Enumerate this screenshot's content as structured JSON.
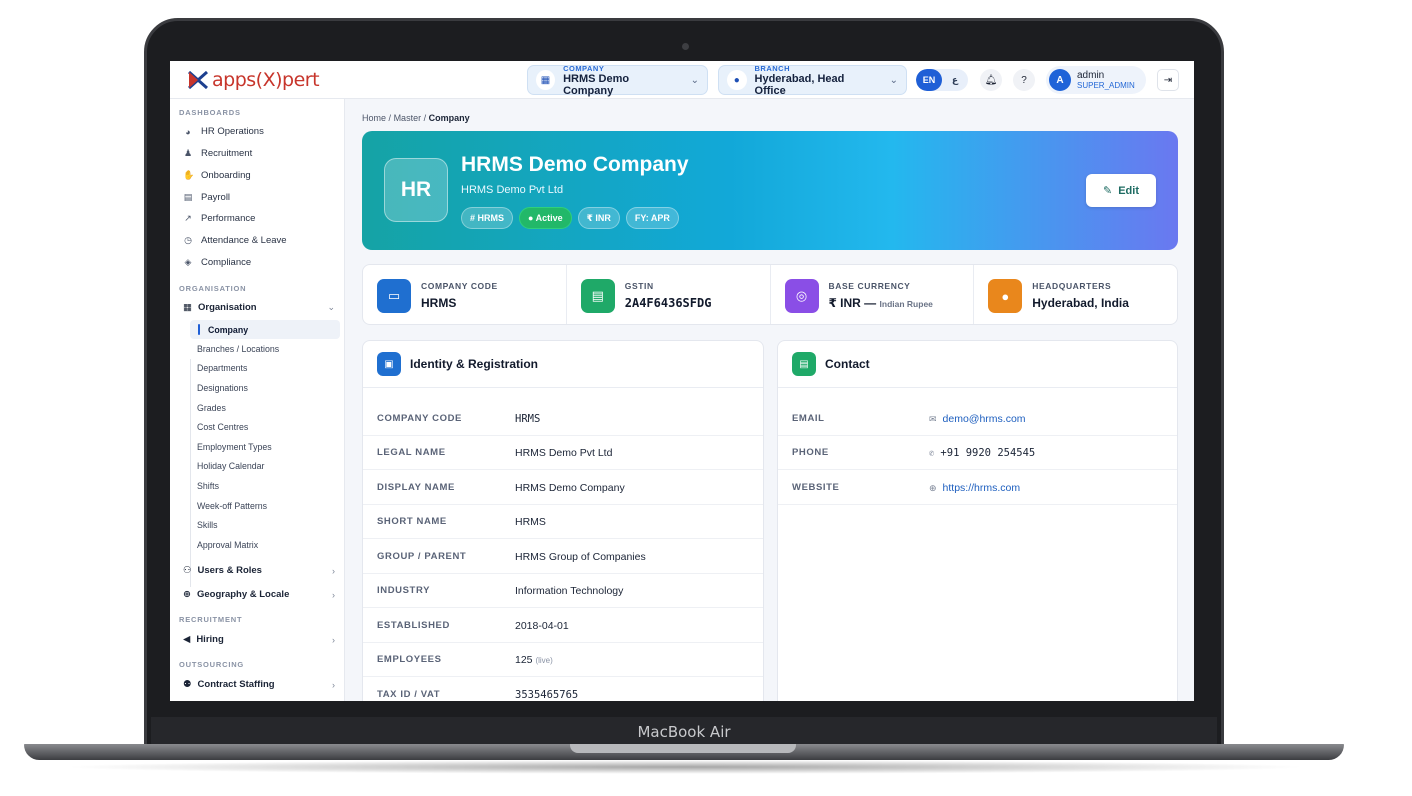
{
  "device": {
    "label": "MacBook Air"
  },
  "brand": {
    "logo_text": "apps(X)pert"
  },
  "header": {
    "company": {
      "caption": "COMPANY",
      "value": "HRMS Demo Company"
    },
    "branch": {
      "caption": "BRANCH",
      "value": "Hyderabad, Head Office"
    },
    "languages": [
      "EN",
      "ع"
    ],
    "user": {
      "initial": "A",
      "name": "admin",
      "role": "SUPER_ADMIN"
    }
  },
  "sidebar": {
    "dashboards_title": "DASHBOARDS",
    "dashboards": [
      {
        "label": "HR Operations",
        "icon": "gauge-icon"
      },
      {
        "label": "Recruitment",
        "icon": "user-plus-icon"
      },
      {
        "label": "Onboarding",
        "icon": "handshake-icon"
      },
      {
        "label": "Payroll",
        "icon": "money-icon"
      },
      {
        "label": "Performance",
        "icon": "chart-line-icon"
      },
      {
        "label": "Attendance & Leave",
        "icon": "clock-icon"
      },
      {
        "label": "Compliance",
        "icon": "shield-icon"
      }
    ],
    "organisation_title": "ORGANISATION",
    "organisation_group": "Organisation",
    "organisation_items": [
      "Company",
      "Branches / Locations",
      "Departments",
      "Designations",
      "Grades",
      "Cost Centres",
      "Employment Types",
      "Holiday Calendar",
      "Shifts",
      "Week-off Patterns",
      "Skills",
      "Approval Matrix"
    ],
    "users_roles": "Users & Roles",
    "geography": "Geography & Locale",
    "recruitment_title": "RECRUITMENT",
    "hiring": "Hiring",
    "outsourcing_title": "OUTSOURCING",
    "contract_staffing": "Contract Staffing"
  },
  "breadcrumb": {
    "home": "Home",
    "master": "Master",
    "current": "Company",
    "sep": "/"
  },
  "hero": {
    "initials": "HR",
    "title": "HRMS Demo Company",
    "subtitle": "HRMS Demo Pvt Ltd",
    "chips": [
      "# HRMS",
      "● Active",
      "₹ INR",
      "FY: APR"
    ],
    "edit_label": "Edit",
    "gradient": [
      "#15a3a5",
      "#12a8d8",
      "#6a78f0"
    ]
  },
  "stats": [
    {
      "caption": "COMPANY CODE",
      "value": "HRMS",
      "color": "#1f6fd0"
    },
    {
      "caption": "GSTIN",
      "value": "2A4F6436SFDG",
      "color": "#1fa968"
    },
    {
      "caption": "BASE CURRENCY",
      "value": "₹ INR —",
      "extra": "Indian Rupee",
      "color": "#8a4ee6"
    },
    {
      "caption": "HEADQUARTERS",
      "value": "Hyderabad, India",
      "color": "#e9871c"
    }
  ],
  "identity": {
    "title": "Identity & Registration",
    "rows": [
      {
        "k": "COMPANY CODE",
        "v": "HRMS"
      },
      {
        "k": "LEGAL NAME",
        "v": "HRMS Demo Pvt Ltd"
      },
      {
        "k": "DISPLAY NAME",
        "v": "HRMS Demo Company"
      },
      {
        "k": "SHORT NAME",
        "v": "HRMS"
      },
      {
        "k": "GROUP / PARENT",
        "v": "HRMS Group of Companies"
      },
      {
        "k": "INDUSTRY",
        "v": "Information Technology"
      },
      {
        "k": "ESTABLISHED",
        "v": "2018-04-01"
      },
      {
        "k": "EMPLOYEES",
        "v": "125",
        "extra": "(live)"
      },
      {
        "k": "TAX ID / VAT",
        "v": "3535465765"
      }
    ]
  },
  "contact": {
    "title": "Contact",
    "rows": [
      {
        "k": "EMAIL",
        "v": "demo@hrms.com"
      },
      {
        "k": "PHONE",
        "v": "+91 9920 254545"
      },
      {
        "k": "WEBSITE",
        "v": "https://hrms.com"
      }
    ]
  }
}
